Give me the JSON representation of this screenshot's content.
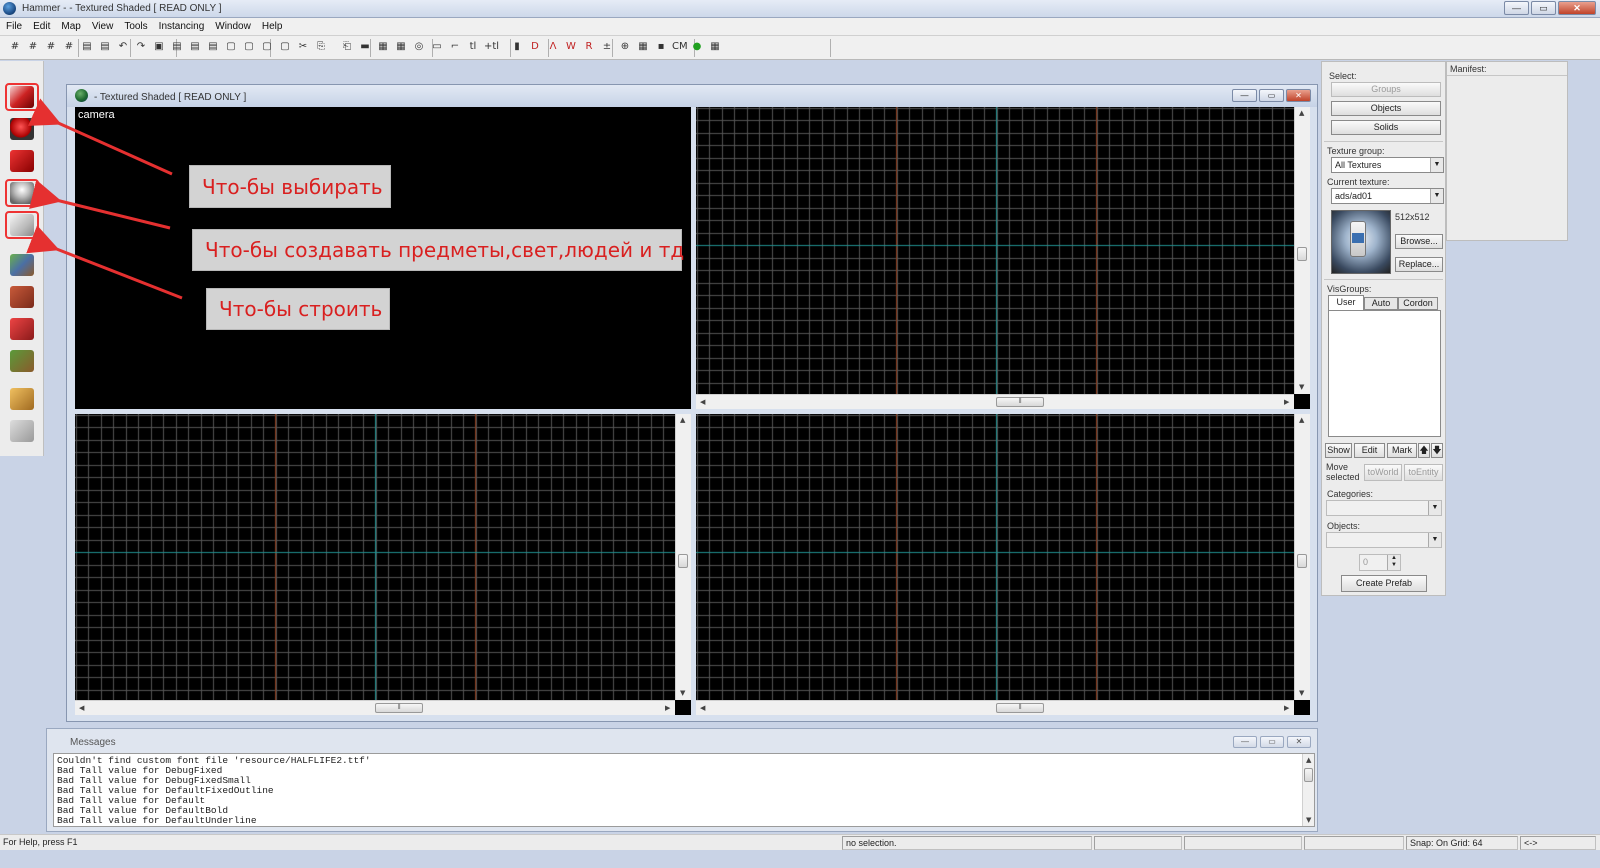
{
  "window": {
    "title": "Hammer - - Textured Shaded [ READ ONLY ]",
    "buttons": {
      "minimize": "—",
      "maximize": "▭",
      "close": "✕"
    }
  },
  "menu": [
    "File",
    "Edit",
    "Map",
    "View",
    "Tools",
    "Instancing",
    "Window",
    "Help"
  ],
  "toolbar_glyphs": [
    "#",
    "#",
    "#",
    "#",
    "▤",
    "▤",
    "↶",
    "↷",
    "▣",
    "▤",
    "▤",
    "▤",
    "▢",
    "▢",
    "▢",
    "▢",
    "✂",
    "⎘",
    "⎗",
    "▬",
    "▦",
    "▦",
    "◎",
    "▭",
    "⌐",
    "tl",
    "+tl",
    "▮",
    "D",
    "Λ",
    "W",
    "R",
    "±",
    "⊕",
    "▦",
    "▪",
    "CM",
    "●",
    "▦"
  ],
  "left_tools": [
    {
      "name": "selection-tool",
      "icon": "pointer-icon",
      "highlighted": true
    },
    {
      "name": "magnify-tool",
      "icon": "magnify-icon",
      "highlighted": false
    },
    {
      "name": "camera-tool",
      "icon": "camera-icon",
      "highlighted": false
    },
    {
      "name": "entity-tool",
      "icon": "entity-icon",
      "highlighted": true
    },
    {
      "name": "block-tool",
      "icon": "block-icon",
      "highlighted": true
    },
    {
      "name": "texture-app-tool",
      "icon": "texture-icon",
      "highlighted": false
    },
    {
      "name": "apply-decals-tool",
      "icon": "decal-icon",
      "highlighted": false
    },
    {
      "name": "apply-overlays-tool",
      "icon": "overlay-icon",
      "highlighted": false
    },
    {
      "name": "clipping-tool",
      "icon": "clip-icon",
      "highlighted": false
    },
    {
      "name": "vertex-tool",
      "icon": "vertex-icon",
      "highlighted": false
    },
    {
      "name": "path-tool",
      "icon": "path-icon",
      "highlighted": false
    }
  ],
  "child_window": {
    "title": "- Textured Shaded [ READ ONLY ]",
    "camera_label": "camera"
  },
  "annotations": [
    "Что-бы выбирать",
    "Что-бы создавать предметы,свет,людей и тд",
    "Что-бы строить"
  ],
  "right_panel": {
    "select_label": "Select:",
    "groups": "Groups",
    "objects": "Objects",
    "solids": "Solids",
    "texture_group_label": "Texture group:",
    "texture_group_value": "All Textures",
    "current_texture_label": "Current texture:",
    "current_texture_value": "ads/ad01",
    "texture_size": "512x512",
    "browse": "Browse...",
    "replace": "Replace...",
    "visgroups_label": "VisGroups:",
    "tabs": [
      "User",
      "Auto",
      "Cordon"
    ],
    "show": "Show",
    "edit": "Edit",
    "mark": "Mark",
    "up_arrow": "🡅",
    "down_arrow": "🡇",
    "move_selected": "Move selected",
    "to_world": "toWorld",
    "to_entity": "toEntity",
    "categories_label": "Categories:",
    "objects_label": "Objects:",
    "spin_value": "0",
    "create_prefab": "Create Prefab"
  },
  "manifest": {
    "title": "Manifest:"
  },
  "messages": {
    "title": "Messages",
    "lines": [
      "Couldn't find custom font file 'resource/HALFLIFE2.ttf'",
      "Bad Tall value for DebugFixed",
      "Bad Tall value for DebugFixedSmall",
      "Bad Tall value for DefaultFixedOutline",
      "Bad Tall value for Default",
      "Bad Tall value for DefaultBold",
      "Bad Tall value for DefaultUnderline"
    ]
  },
  "status": {
    "help": "For Help, press F1",
    "selection": "no selection.",
    "snap": "Snap: On Grid: 64",
    "nav": "<->"
  },
  "colors": {
    "grid_line": "#555555",
    "grid_axis": "#1f8f8f",
    "grid_major": "#8a3a1a",
    "annotation_text": "#d92020",
    "highlight": "#ee3333"
  }
}
